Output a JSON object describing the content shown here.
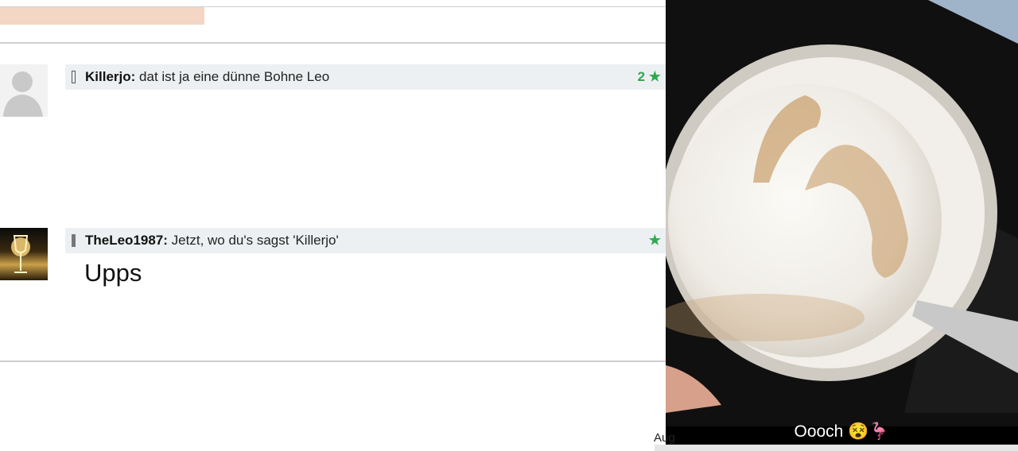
{
  "comments": [
    {
      "user": "Killerjo:",
      "text": "dat ist ja eine dünne Bohne Leo",
      "rating": "2 ★",
      "body": ""
    },
    {
      "user": "TheLeo1987:",
      "text": "Jetzt, wo du's sagst 'Killerjo'",
      "rating": "★",
      "body": "Upps"
    }
  ],
  "photo": {
    "caption": "Oooch 😵🦩"
  },
  "date_stub": "Aug"
}
